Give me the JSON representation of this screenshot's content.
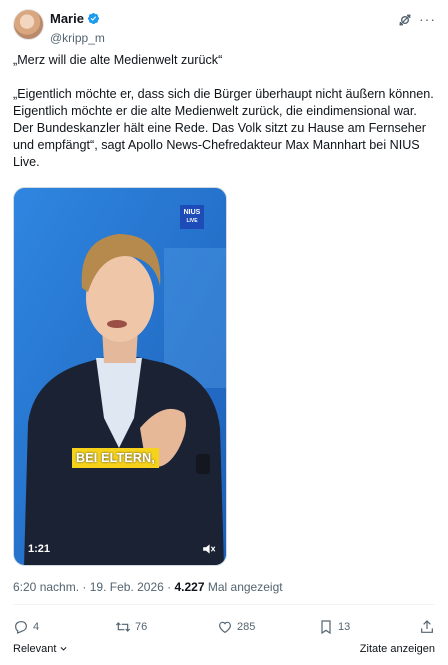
{
  "author": {
    "name": "Marie",
    "handle": "@kripp_m"
  },
  "tweet": {
    "title": "„Merz will die alte Medienwelt zurück“",
    "body": "„Eigentlich möchte er, dass sich die Bürger überhaupt nicht äußern können. Eigentlich möchte er die alte Medienwelt zurück, die eindimensional war. Der Bundeskanzler hält eine Rede. Das Volk sitzt zu Hause am Fernseher und empfängt“, sagt Apollo News-Chefredakteur Max Mannhart bei NIUS Live."
  },
  "media": {
    "logo_text": "NIUS",
    "logo_sub": "LIVE",
    "caption": "BEI ELTERN,",
    "duration": "1:21"
  },
  "meta": {
    "time": "6:20 nachm.",
    "separator": "·",
    "date": "19. Feb. 2026",
    "views": "4.227",
    "views_label": "Mal angezeigt"
  },
  "actions": {
    "replies": "4",
    "retweets": "76",
    "likes": "285",
    "bookmarks": "13"
  },
  "footer": {
    "relevant": "Relevant",
    "translate": "Zitate anzeigen"
  },
  "colors": {
    "verified": "#1d9bf0",
    "secondary_text": "#536471",
    "caption_bg": "#f6d21b",
    "studio_blue": "#2b7bd8"
  },
  "icons": [
    "verified-icon",
    "grok-icon",
    "more-icon",
    "reply-icon",
    "retweet-icon",
    "like-icon",
    "bookmark-icon",
    "share-icon",
    "volume-icon",
    "chevron-down-icon"
  ]
}
